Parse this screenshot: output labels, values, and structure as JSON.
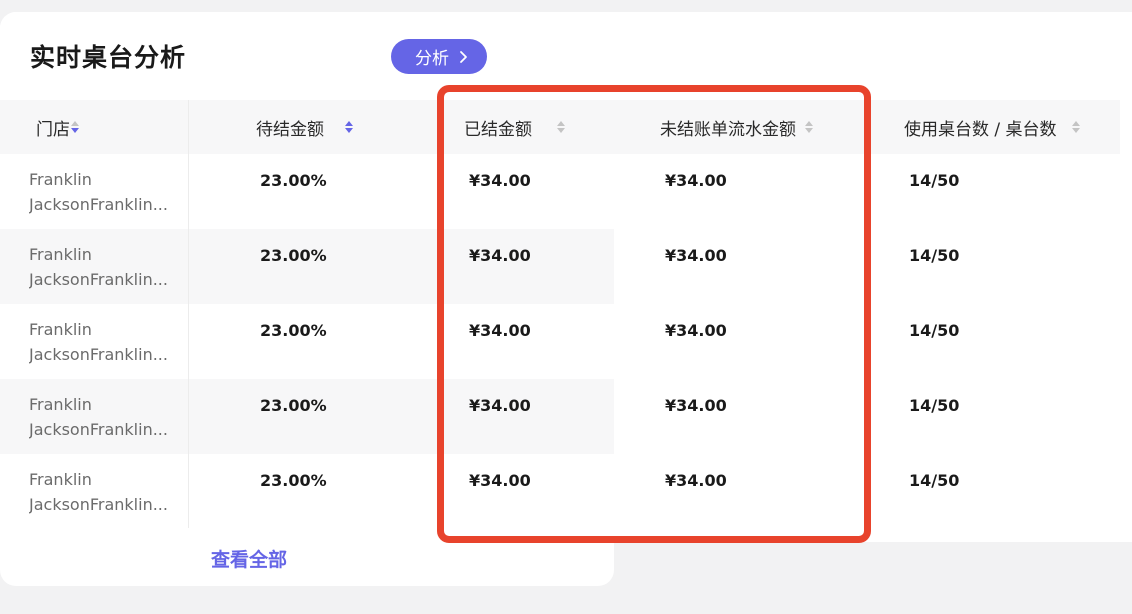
{
  "card": {
    "title": "实时桌台分析",
    "analyze_button": "分析"
  },
  "table": {
    "columns": [
      {
        "label": "门店"
      },
      {
        "label": "待结金额"
      },
      {
        "label": "已结金额"
      },
      {
        "label": "未结账单流水金额"
      },
      {
        "label": "使用桌台数 / 桌台数"
      }
    ],
    "rows": [
      {
        "store_line1": "Franklin",
        "store_line2": "JacksonFranklin...",
        "pending": "23.00%",
        "settled": "¥34.00",
        "unsettled_flow": "¥34.00",
        "tables": "14/50"
      },
      {
        "store_line1": "Franklin",
        "store_line2": "JacksonFranklin...",
        "pending": "23.00%",
        "settled": "¥34.00",
        "unsettled_flow": "¥34.00",
        "tables": "14/50"
      },
      {
        "store_line1": "Franklin",
        "store_line2": "JacksonFranklin...",
        "pending": "23.00%",
        "settled": "¥34.00",
        "unsettled_flow": "¥34.00",
        "tables": "14/50"
      },
      {
        "store_line1": "Franklin",
        "store_line2": "JacksonFranklin...",
        "pending": "23.00%",
        "settled": "¥34.00",
        "unsettled_flow": "¥34.00",
        "tables": "14/50"
      },
      {
        "store_line1": "Franklin",
        "store_line2": "JacksonFranklin...",
        "pending": "23.00%",
        "settled": "¥34.00",
        "unsettled_flow": "¥34.00",
        "tables": "14/50"
      }
    ]
  },
  "footer": {
    "view_all": "查看全部"
  },
  "colors": {
    "accent": "#6565e6",
    "highlight_border": "#e8432c",
    "stripe": "#f7f7f8"
  }
}
